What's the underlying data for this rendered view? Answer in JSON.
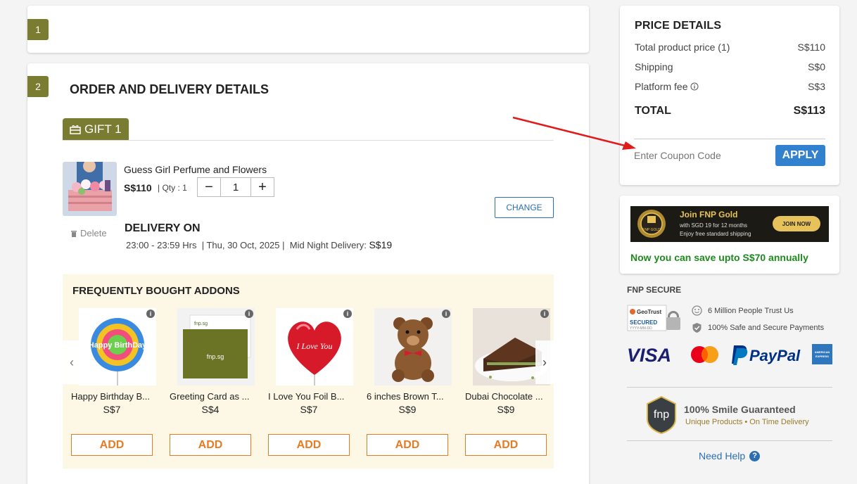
{
  "steps": {
    "step1": {
      "number": "1"
    },
    "step2": {
      "number": "2",
      "title": "ORDER AND DELIVERY DETAILS"
    }
  },
  "gift": {
    "tab_label": "GIFT 1",
    "product_name": "Guess Girl Perfume and Flowers",
    "price": "S$110",
    "qty_label": "| Qty : 1",
    "qty_value": "1",
    "change_label": "CHANGE",
    "delete_label": "Delete",
    "delivery_title": "DELIVERY ON",
    "delivery_time": "23:00 - 23:59 Hrs",
    "delivery_date": "| Thu, 30 Oct, 2025 |",
    "delivery_type_label": "Mid Night Delivery:",
    "delivery_fee": "S$19"
  },
  "addons": {
    "title": "FREQUENTLY BOUGHT ADDONS",
    "add_label": "ADD",
    "items": [
      {
        "name": "Happy Birthday B...",
        "price": "S$7"
      },
      {
        "name": "Greeting Card as ...",
        "price": "S$4"
      },
      {
        "name": "I Love You Foil B...",
        "price": "S$7"
      },
      {
        "name": "6 inches Brown T...",
        "price": "S$9"
      },
      {
        "name": "Dubai Chocolate ...",
        "price": "S$9"
      }
    ],
    "image_text": {
      "balloon_text": "Happy BirthDay",
      "card_text": "fnp.sg",
      "heart_text": "I Love You"
    }
  },
  "price_details": {
    "title": "PRICE DETAILS",
    "rows": [
      {
        "label": "Total product price (1)",
        "value": "S$110"
      },
      {
        "label": "Shipping",
        "value": "S$0"
      },
      {
        "label": "Platform fee",
        "value": "S$3"
      }
    ],
    "total_label": "TOTAL",
    "total_value": "S$113",
    "coupon_placeholder": "Enter Coupon Code",
    "apply_label": "APPLY"
  },
  "fnp_gold": {
    "heading": "Join FNP Gold",
    "line1": "with SGD 19 for 12 months",
    "line2": "Enjoy free standard shipping",
    "join_label": "JOIN NOW",
    "badge_text": "FNP GOLD",
    "savings_text": "Now you can save upto S$70 annually"
  },
  "secure": {
    "title": "FNP SECURE",
    "geotrust_name": "GeoTrust",
    "geotrust_label": "SECURED",
    "geotrust_sub": "YYYY-MM-DD",
    "trust1": "6 Million People Trust Us",
    "trust2": "100% Safe and Secure Payments",
    "visa": "VISA",
    "paypal": "PayPal",
    "amex": "AMERICAN EXPRESS",
    "smile_title": "100% Smile Guaranteed",
    "smile_sub": "Unique Products • On Time Delivery",
    "fnp_logo": "fnp",
    "help": "Need Help",
    "help_icon": "?"
  },
  "colors": {
    "olive": "#7a7d31",
    "blue": "#3181cf",
    "orange": "#e37c24",
    "green": "#1e8a1e",
    "arrow": "#e01b1b"
  }
}
